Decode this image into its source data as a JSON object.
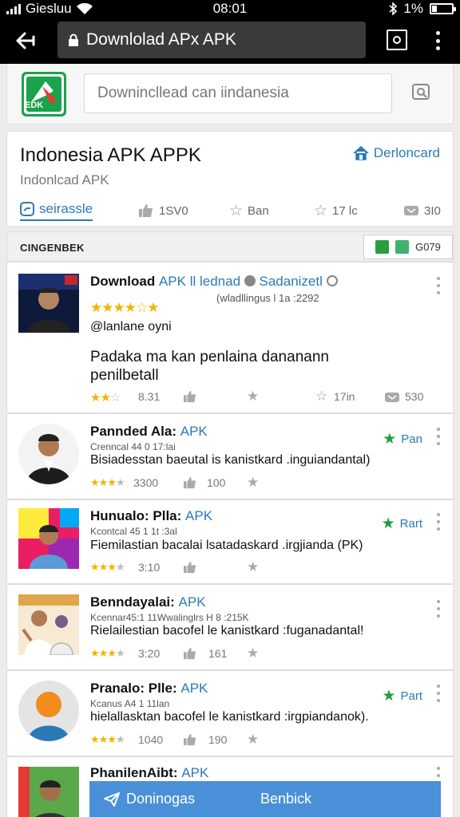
{
  "status_bar": {
    "carrier": "Giesluu",
    "time": "08:01",
    "battery": "1%"
  },
  "browser": {
    "url": "Downlolad APx APK"
  },
  "site": {
    "logo_text": "EDK",
    "search_placeholder": "Downincllead can iindanesia"
  },
  "title_card": {
    "title": "Indonesia APK APPK",
    "subtitle": "Indonlcad APK",
    "download_link": "Derloncard",
    "active_tab": "seirassle",
    "stats": [
      "1SV0",
      "Ban",
      "17 lc",
      "3I0"
    ]
  },
  "section": {
    "title": "CINGENBEK",
    "badge": "G079"
  },
  "apps": [
    {
      "title": "Download",
      "title_apk": "APK ll lednad",
      "title_suffix": "Sadanizetl",
      "meta": "(wladllingus l 1a :2292",
      "handle": "@lanlane oyni",
      "desc_line1": "Padaka ma kan penlaina dananann",
      "desc_line2": "penilbetall",
      "rating_value": "8.31",
      "downloads": "17in",
      "size": "530",
      "star_rating": 4.5
    },
    {
      "title": "Pannded Ala:",
      "title_apk": "APK",
      "meta": "Crenncal 44 0 17:lai",
      "desc": "Bisiadesstan baeutal is kanistkard .inguiandantal)",
      "rating_value": "3300",
      "count": "100",
      "plan": "Pan",
      "star_rating": 3.5
    },
    {
      "title": "Hunualo: Plla:",
      "title_apk": "APK",
      "meta": "Kcontcal 45 1 1t :3al",
      "desc": "Fiemilastian bacalai lsatadaskard .irgjianda (PK)",
      "rating_value": "3:10",
      "plan": "Rart",
      "star_rating": 3.5
    },
    {
      "title": "Benndayalai:",
      "title_apk": "APK",
      "meta": "Kcennar45:1 11Wwalinglrs H 8 :215K",
      "desc": "Rielailestian bacofel le kanistkard :fuganadantal!",
      "rating_value": "3:20",
      "count": "161",
      "star_rating": 3.5
    },
    {
      "title": "Pranalo: Plle:",
      "title_apk": "APK",
      "meta": "Kcanus A4 1 11lan",
      "desc": "hielallasktan bacofel le kanistkard :irgpiandanok).",
      "rating_value": "1040",
      "count": "190",
      "plan": "Part",
      "star_rating": 3.5
    },
    {
      "title": "PhanilenAibt:",
      "title_apk": "APK"
    }
  ],
  "bottom_bar": {
    "left": "Doninogas",
    "right": "Benbick"
  },
  "colors": {
    "accent_blue": "#2a7ab8",
    "star_yellow": "#f2b400",
    "green": "#1e9e3c",
    "bottom_bar": "#4a90d9"
  },
  "icons": [
    "back-arrow-icon",
    "lock-icon",
    "tabs-icon",
    "overflow-menu-icon",
    "search-icon",
    "home-icon",
    "timer-icon",
    "thumbs-up-icon",
    "star-icon",
    "tag-icon",
    "send-icon"
  ]
}
